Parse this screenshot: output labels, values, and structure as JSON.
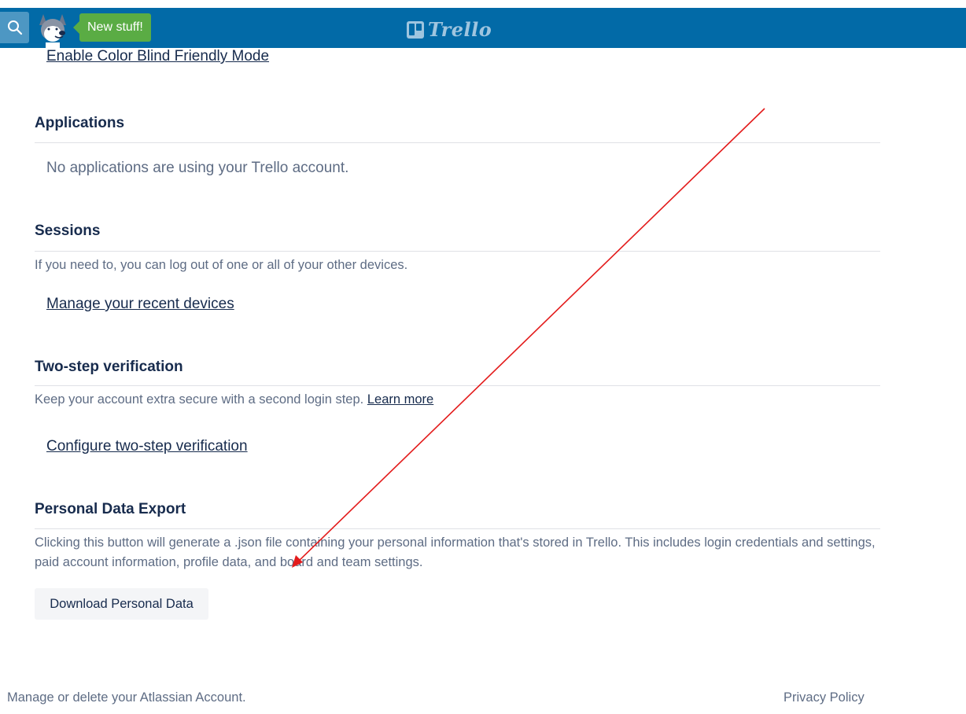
{
  "header": {
    "new_stuff_label": "New stuff!",
    "logo_text": "Trello",
    "colors": {
      "bar": "#026aa7",
      "badge": "#5aac44"
    }
  },
  "accessibility": {
    "color_blind_link": "Enable Color Blind Friendly Mode"
  },
  "applications": {
    "title": "Applications",
    "empty_text": "No applications are using your Trello account."
  },
  "sessions": {
    "title": "Sessions",
    "description": "If you need to, you can log out of one or all of your other devices.",
    "manage_link": "Manage your recent devices"
  },
  "two_step": {
    "title": "Two-step verification",
    "description": "Keep your account extra secure with a second login step.",
    "learn_more": "Learn more",
    "configure_link": "Configure two-step verification"
  },
  "export": {
    "title": "Personal Data Export",
    "description": "Clicking this button will generate a .json file containing your personal information that's stored in Trello. This includes login credentials and settings, paid account information, profile data, and board and team settings.",
    "button_label": "Download Personal Data"
  },
  "footer": {
    "atlassian_link": "Manage or delete your Atlassian Account.",
    "privacy_link": "Privacy Policy"
  },
  "annotation": {
    "arrow_color": "#e31b1b"
  }
}
